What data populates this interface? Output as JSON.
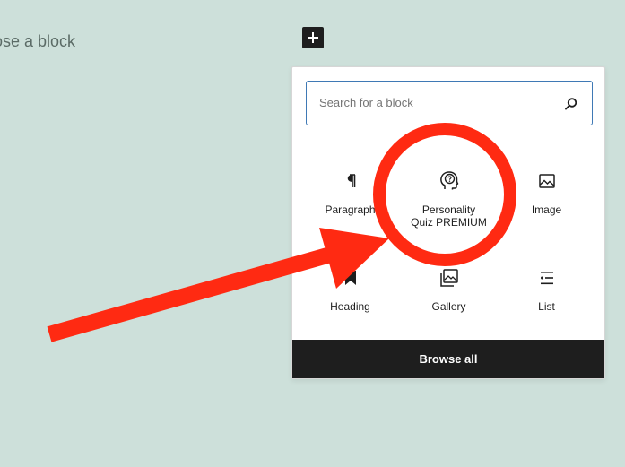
{
  "editor": {
    "placeholder": "ose a block"
  },
  "inserter": {
    "search": {
      "placeholder": "Search for a block",
      "value": ""
    },
    "blocks": [
      {
        "label": "Paragraph",
        "icon": "paragraph-icon"
      },
      {
        "label": "Personality\nQuiz PREMIUM",
        "icon": "head-question-icon"
      },
      {
        "label": "Image",
        "icon": "image-icon"
      },
      {
        "label": "Heading",
        "icon": "bookmark-icon"
      },
      {
        "label": "Gallery",
        "icon": "gallery-icon"
      },
      {
        "label": "List",
        "icon": "list-icon"
      }
    ],
    "browse_all": "Browse all"
  },
  "annotation": {
    "circle_color": "#ff2a12",
    "arrow_color": "#ff2a12"
  }
}
